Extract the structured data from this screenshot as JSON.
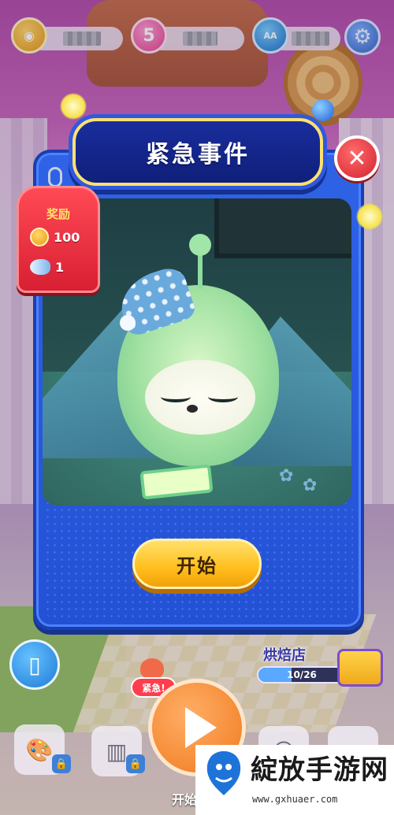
{
  "hud": {
    "hearts_count": "5",
    "cap_icon_text": "AA"
  },
  "modal": {
    "title": "紧急事件",
    "reward": {
      "title": "奖励",
      "coins": "100",
      "fish": "1"
    },
    "start_label": "开始"
  },
  "bakery": {
    "name": "烘焙店",
    "progress_text": "10/26",
    "progress_value": 10,
    "progress_max": 26
  },
  "bottom": {
    "urgent_badge": "紧急!",
    "start_caption": "开始"
  },
  "watermark": {
    "title": "綻放手游网",
    "url": "www.gxhuaer.com"
  },
  "colors": {
    "modal_blue": "#2f63e6",
    "title_border": "#ffe170",
    "start_button": "#ffbe1c",
    "close_red": "#d3222f",
    "reward_red": "#d81f33"
  }
}
